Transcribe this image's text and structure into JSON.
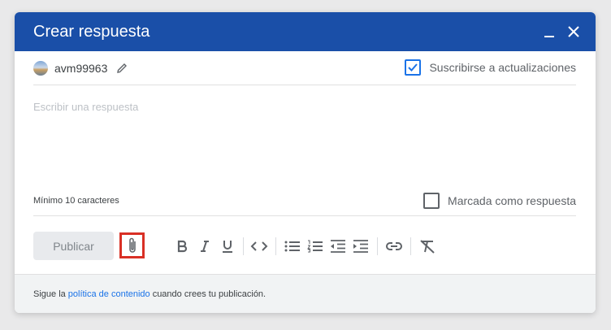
{
  "dialog": {
    "title": "Crear respuesta",
    "header_color": "#1a4fa8"
  },
  "user": {
    "name": "avm99963"
  },
  "subscribe": {
    "label": "Suscribirse a actualizaciones",
    "checked": true
  },
  "editor": {
    "placeholder": "Escribir una respuesta",
    "min_chars": "Mínimo 10 caracteres"
  },
  "answer": {
    "label": "Marcada como respuesta",
    "checked": false
  },
  "toolbar": {
    "publish_label": "Publicar",
    "icons": [
      "paperclip-icon",
      "bold-icon",
      "italic-icon",
      "underline-icon",
      "code-icon",
      "bulleted-list-icon",
      "numbered-list-icon",
      "indent-decrease-icon",
      "indent-increase-icon",
      "link-icon",
      "clear-format-icon"
    ]
  },
  "footer": {
    "prefix": "Sigue la",
    "link": "política de contenido",
    "suffix": "cuando crees tu publicación."
  },
  "colors": {
    "accent": "#1a73e8",
    "highlight": "#d93025"
  }
}
